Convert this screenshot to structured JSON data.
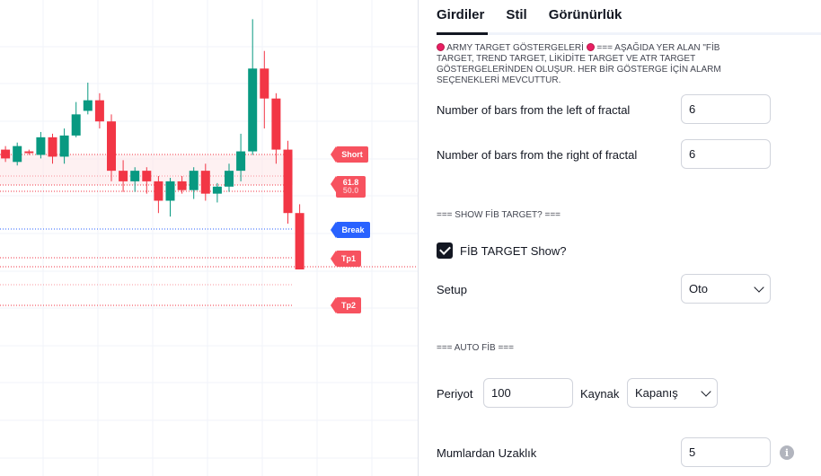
{
  "chart": {
    "tags": {
      "short": "Short",
      "fib_618": "61.8",
      "fib_500": "50.0",
      "break": "Break",
      "tp1": "Tp1",
      "tp2": "Tp2"
    },
    "colors": {
      "bull": "#089981",
      "bear": "#f23645",
      "tag_red": "#f7525f",
      "tag_blue": "#2962ff"
    },
    "candles": [
      {
        "o": 156,
        "c": 153,
        "h": 150,
        "l": 159
      },
      {
        "o": 158,
        "c": 153,
        "h": 151,
        "l": 160
      },
      {
        "o": 151,
        "c": 160,
        "h": 149,
        "l": 162
      },
      {
        "o": 157,
        "c": 156,
        "h": 155,
        "l": 158
      },
      {
        "o": 155,
        "c": 165,
        "h": 153,
        "l": 168
      },
      {
        "o": 165,
        "c": 154,
        "h": 150,
        "l": 167
      },
      {
        "o": 154,
        "c": 166,
        "h": 150,
        "l": 170
      },
      {
        "o": 166,
        "c": 178,
        "h": 165,
        "l": 185
      },
      {
        "o": 180,
        "c": 186,
        "h": 178,
        "l": 196
      },
      {
        "o": 186,
        "c": 174,
        "h": 170,
        "l": 190
      },
      {
        "o": 174,
        "c": 146,
        "h": 140,
        "l": 178
      },
      {
        "o": 146,
        "c": 140,
        "h": 134,
        "l": 152
      },
      {
        "o": 140,
        "c": 146,
        "h": 134,
        "l": 148
      },
      {
        "o": 146,
        "c": 140,
        "h": 133,
        "l": 148
      },
      {
        "o": 140,
        "c": 129,
        "h": 122,
        "l": 143
      },
      {
        "o": 129,
        "c": 140,
        "h": 120,
        "l": 142
      },
      {
        "o": 140,
        "c": 135,
        "h": 133,
        "l": 143
      },
      {
        "o": 135,
        "c": 146,
        "h": 130,
        "l": 148
      },
      {
        "o": 146,
        "c": 133,
        "h": 129,
        "l": 150
      },
      {
        "o": 133,
        "c": 137,
        "h": 128,
        "l": 139
      },
      {
        "o": 137,
        "c": 146,
        "h": 134,
        "l": 150
      },
      {
        "o": 146,
        "c": 157,
        "h": 140,
        "l": 167
      },
      {
        "o": 157,
        "c": 204,
        "h": 155,
        "l": 232
      },
      {
        "o": 204,
        "c": 187,
        "h": 170,
        "l": 214
      },
      {
        "o": 187,
        "c": 158,
        "h": 150,
        "l": 190
      },
      {
        "o": 158,
        "c": 122,
        "h": 116,
        "l": 163
      },
      {
        "o": 122,
        "c": 90,
        "h": 90,
        "l": 127
      }
    ]
  },
  "tabs": [
    "Girdiler",
    "Stil",
    "Görünürlük"
  ],
  "description": "ARMY TARGET GÖSTERGELERİ",
  "description_rest": " === AŞAĞIDA YER ALAN \"FİB TARGET, TREND TARGET, LİKİDİTE TARGET VE ATR TARGET GÖSTERGELERİNDEN OLUŞUR. HER BİR GÖSTERGE İÇİN ALARM SEÇENEKLERİ MEVCUTTUR.",
  "fields": {
    "left_bars_label": "Number of bars from the left of fractal",
    "left_bars_value": "6",
    "right_bars_label": "Number of bars from the right of fractal",
    "right_bars_value": "6",
    "show_fib_section": "=== SHOW FİB TARGET? ===",
    "fib_show_label": "FİB TARGET Show?",
    "setup_label": "Setup",
    "setup_value": "Oto",
    "auto_fib_section": "=== AUTO FİB ===",
    "period_label": "Periyot",
    "period_value": "100",
    "source_label": "Kaynak",
    "source_value": "Kapanış",
    "distance_label": "Mumlardan Uzaklık",
    "distance_value": "5",
    "info_icon": "i"
  }
}
